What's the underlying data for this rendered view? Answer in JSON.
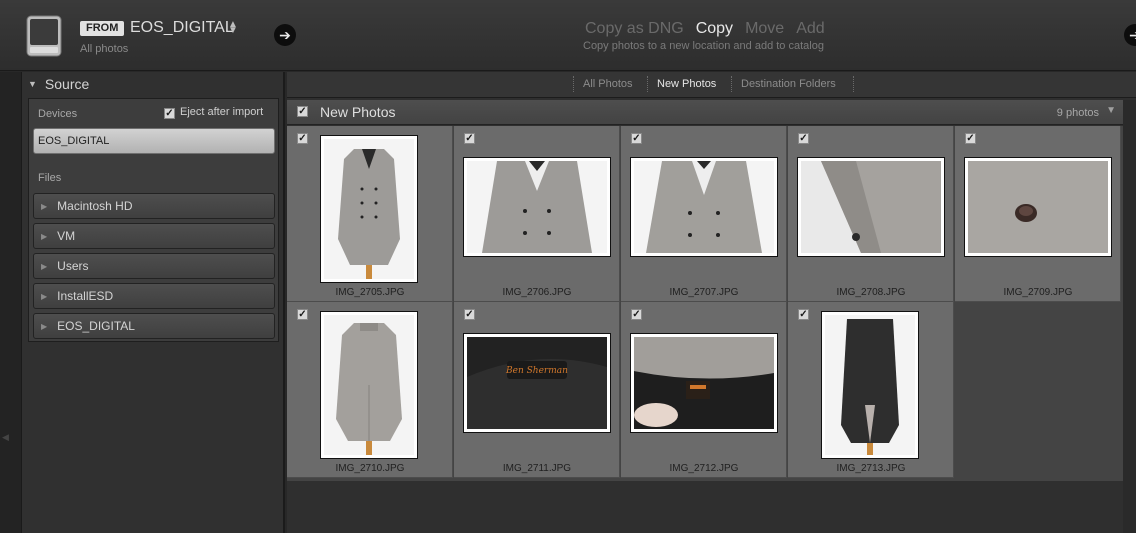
{
  "header": {
    "from_label": "FROM",
    "source_name": "EOS_DIGITAL",
    "source_subtitle": "All photos",
    "modes": [
      "Copy as DNG",
      "Copy",
      "Move",
      "Add"
    ],
    "active_mode": "Copy",
    "mode_description": "Copy photos to a new location and add to catalog"
  },
  "source_panel": {
    "title": "Source",
    "devices_label": "Devices",
    "eject_label": "Eject after import",
    "eject_checked": true,
    "selected_device": "EOS_DIGITAL",
    "files_label": "Files",
    "files": [
      "Macintosh HD",
      "VM",
      "Users",
      "InstallESD",
      "EOS_DIGITAL"
    ]
  },
  "filters": {
    "items": [
      "All Photos",
      "New Photos",
      "Destination Folders"
    ],
    "active": "New Photos"
  },
  "grid": {
    "title": "New Photos",
    "count": "9 photos",
    "photos": [
      {
        "name": "IMG_2705.JPG",
        "checked": true,
        "orientation": "portrait",
        "subject": "coat-front"
      },
      {
        "name": "IMG_2706.JPG",
        "checked": true,
        "orientation": "landscape",
        "subject": "coat-chest"
      },
      {
        "name": "IMG_2707.JPG",
        "checked": true,
        "orientation": "landscape",
        "subject": "coat-chest"
      },
      {
        "name": "IMG_2708.JPG",
        "checked": true,
        "orientation": "landscape",
        "subject": "coat-lapel"
      },
      {
        "name": "IMG_2709.JPG",
        "checked": true,
        "orientation": "landscape",
        "subject": "button-closeup"
      },
      {
        "name": "IMG_2710.JPG",
        "checked": true,
        "orientation": "portrait",
        "subject": "coat-back"
      },
      {
        "name": "IMG_2711.JPG",
        "checked": true,
        "orientation": "landscape",
        "subject": "lining-label"
      },
      {
        "name": "IMG_2712.JPG",
        "checked": true,
        "orientation": "landscape",
        "subject": "collar-label"
      },
      {
        "name": "IMG_2713.JPG",
        "checked": true,
        "orientation": "portrait",
        "subject": "coat-inside"
      }
    ]
  },
  "colors": {
    "coat_gray": "#9d9b98",
    "lining_black": "#222222",
    "label_orange": "#d2782c"
  }
}
